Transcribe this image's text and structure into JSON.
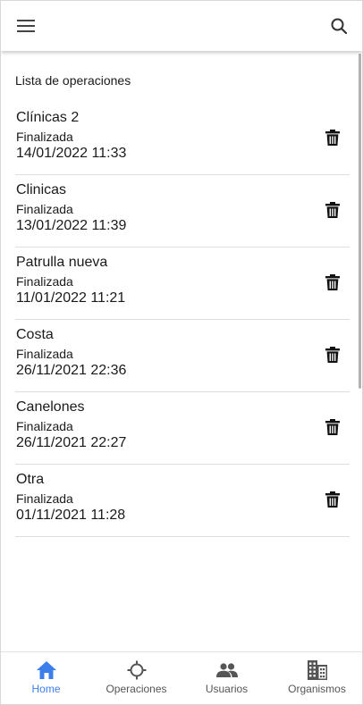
{
  "section_title": "Lista de operaciones",
  "operations": [
    {
      "name": "Clínicas 2",
      "status": "Finalizada",
      "date": "14/01/2022 11:33"
    },
    {
      "name": "Clinicas",
      "status": "Finalizada",
      "date": "13/01/2022 11:39"
    },
    {
      "name": "Patrulla nueva",
      "status": "Finalizada",
      "date": "11/01/2022 11:21"
    },
    {
      "name": "Costa",
      "status": "Finalizada",
      "date": "26/11/2021 22:36"
    },
    {
      "name": "Canelones",
      "status": "Finalizada",
      "date": "26/11/2021 22:27"
    },
    {
      "name": "Otra",
      "status": "Finalizada",
      "date": "01/11/2021 11:28"
    }
  ],
  "icons": {
    "menu": "hamburger-menu-icon",
    "search": "search-icon",
    "delete": "trash-icon",
    "home": "home-icon",
    "operaciones": "crosshair-icon",
    "usuarios": "people-icon",
    "organismos": "building-icon"
  },
  "nav": {
    "items": [
      {
        "label": "Home",
        "active": true
      },
      {
        "label": "Operaciones",
        "active": false
      },
      {
        "label": "Usuarios",
        "active": false
      },
      {
        "label": "Organismos",
        "active": false
      }
    ]
  },
  "colors": {
    "accent": "#3d7fea",
    "inactive": "#555555",
    "text": "#1a1a1a",
    "divider": "#dedede"
  }
}
